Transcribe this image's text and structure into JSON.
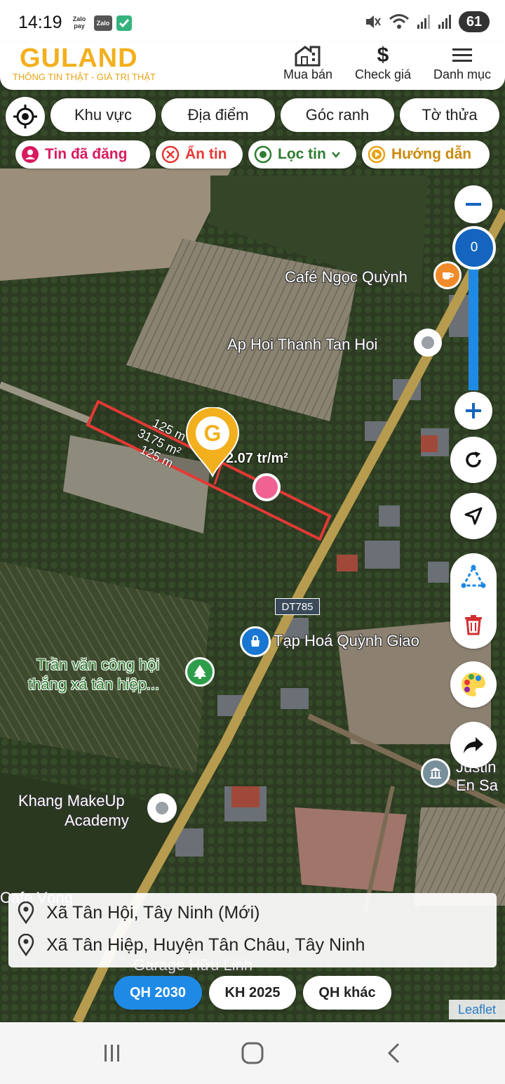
{
  "status_bar": {
    "time": "14:19",
    "app_icons": [
      "Zalo Pay",
      "Zalo"
    ],
    "zalopay_label": "Zalo pay",
    "zalo_label": "Zalo",
    "battery": "61"
  },
  "header": {
    "logo_text": "GULAND",
    "tagline": "THÔNG TIN THẬT - GIÁ TRỊ THẬT",
    "nav": [
      {
        "label": "Mua bán",
        "icon": "house-grid-icon"
      },
      {
        "label": "Check giá",
        "icon": "dollar-icon"
      },
      {
        "label": "Danh mục",
        "icon": "menu-icon"
      }
    ]
  },
  "filters": {
    "pills": [
      "Khu vực",
      "Địa điểm",
      "Góc ranh",
      "Tờ thửa"
    ],
    "chips": [
      {
        "label": "Tin đã đăng",
        "color": "#d81b60",
        "icon": "user-icon"
      },
      {
        "label": "Ẩn tin",
        "color": "#e53935",
        "icon": "close-circle-icon"
      },
      {
        "label": "Lọc tin",
        "color": "#2e7d32",
        "icon": "target-icon"
      },
      {
        "label": "Hướng dẫn",
        "color": "#e9a315",
        "icon": "play-icon"
      }
    ]
  },
  "zoom": {
    "level": "0"
  },
  "map": {
    "labels": {
      "cafe": "Café Ngọc Quỳnh",
      "ap": "Ap Hoi Thanh Tan Hoi",
      "road": "DT785",
      "store": "Tạp Hoá Quỳnh Giao",
      "tree_line1": "Trần văn công hội",
      "tree_line2": "thắng xá tân hiệp...",
      "makeup_line1": "Khang MakeUp",
      "makeup_line2": "Academy",
      "justin_line1": "Justin",
      "justin_line2": "En Sa",
      "cafe_vong": "Cafe Vọng",
      "garage": "Garage Hữu Linh"
    },
    "parcel": {
      "len_top": "125 m",
      "area": "3175 m²",
      "len_bottom": "125 m",
      "price": "2.07 tr/m²"
    }
  },
  "address": {
    "new": "Xã Tân Hội, Tây Ninh (Mới)",
    "old": "Xã Tân Hiệp, Huyện Tân Châu, Tây Ninh"
  },
  "plan_buttons": [
    {
      "label": "QH 2030",
      "active": true
    },
    {
      "label": "KH 2025",
      "active": false
    },
    {
      "label": "QH khác",
      "active": false
    }
  ],
  "attribution": "Leaflet",
  "colors": {
    "brand": "#f2b01e",
    "accent_blue": "#1f8ae6",
    "parcel_outline": "#e53935",
    "marker_pink": "#f06292"
  }
}
